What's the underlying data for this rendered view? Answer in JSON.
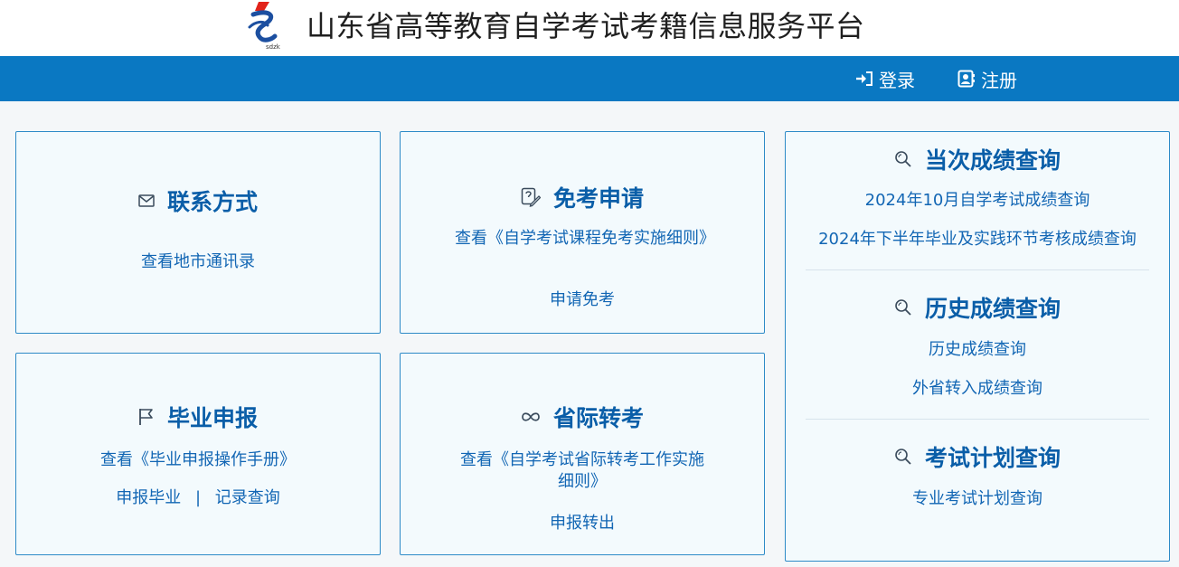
{
  "header": {
    "site_title": "山东省高等教育自学考试考籍信息服务平台",
    "logo_text": "sdzk"
  },
  "nav": {
    "login": "登录",
    "register": "注册"
  },
  "contact": {
    "title": "联系方式",
    "link": "查看地市通讯录"
  },
  "exemption": {
    "title": "免考申请",
    "rules_link": "查看《自学考试课程免考实施细则》",
    "apply_link": "申请免考"
  },
  "graduation": {
    "title": "毕业申报",
    "manual_link": "查看《毕业申报操作手册》",
    "apply_link": "申报毕业",
    "separator": "|",
    "record_link": "记录查询"
  },
  "transfer": {
    "title": "省际转考",
    "rules_link": "查看《自学考试省际转考工作实施细则》",
    "apply_link": "申报转出"
  },
  "scores": {
    "current": {
      "title": "当次成绩查询",
      "links": [
        "2024年10月自学考试成绩查询",
        "2024年下半年毕业及实践环节考核成绩查询"
      ]
    },
    "history": {
      "title": "历史成绩查询",
      "links": [
        "历史成绩查询",
        "外省转入成绩查询"
      ]
    },
    "plan": {
      "title": "考试计划查询",
      "links": [
        "专业考试计划查询"
      ]
    }
  },
  "colors": {
    "nav_bg": "#0a78c2",
    "card_border": "#2d8ac7",
    "title_blue": "#0a5ea8",
    "link_blue": "#1266b4"
  }
}
